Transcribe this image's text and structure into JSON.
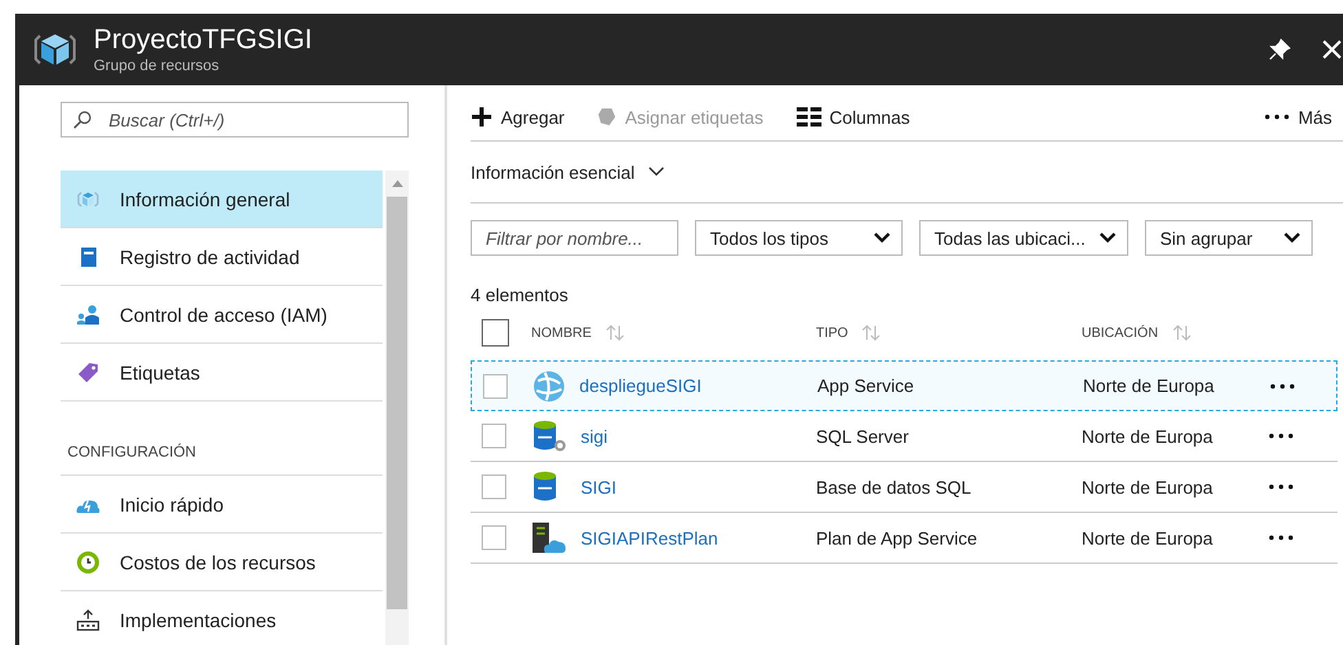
{
  "window": {
    "title": "ProyectoTFGSIGI",
    "subtitle": "Grupo de recursos"
  },
  "sidebar": {
    "search": {
      "placeholder": "Buscar (Ctrl+/)"
    },
    "items": [
      {
        "kind": "item",
        "label": "Información general",
        "selected": true
      },
      {
        "kind": "item",
        "label": "Registro de actividad",
        "selected": false
      },
      {
        "kind": "item",
        "label": "Control de acceso (IAM)",
        "selected": false
      },
      {
        "kind": "item",
        "label": "Etiquetas",
        "selected": false
      },
      {
        "kind": "heading",
        "label": "CONFIGURACIÓN"
      },
      {
        "kind": "item",
        "label": "Inicio rápido",
        "selected": false
      },
      {
        "kind": "item",
        "label": "Costos de los recursos",
        "selected": false
      },
      {
        "kind": "item",
        "label": "Implementaciones",
        "selected": false
      }
    ]
  },
  "toolbar": [
    {
      "label": "Agregar",
      "disabled": false
    },
    {
      "label": "Asignar etiquetas",
      "disabled": true
    },
    {
      "label": "Columnas",
      "disabled": false
    }
  ],
  "more": "Más",
  "essentials": "Información esencial",
  "filters": {
    "name": {
      "placeholder": "Filtrar por nombre..."
    },
    "dropdowns": [
      "Todos los tipos",
      "Todas las ubicaci...",
      "Sin agrupar"
    ]
  },
  "count": "4 elementos",
  "table": {
    "all_checked": false,
    "columns": [
      "NOMBRE",
      "TIPO",
      "UBICACIÓN"
    ],
    "rows": [
      {
        "name": "despliegueSIGI",
        "type": "App Service",
        "location": "Norte de Europa",
        "selected": true,
        "checked": false
      },
      {
        "name": "sigi",
        "type": "SQL Server",
        "location": "Norte de Europa",
        "selected": false,
        "checked": false
      },
      {
        "name": "SIGI",
        "type": "Base de datos SQL",
        "location": "Norte de Europa",
        "selected": false,
        "checked": false
      },
      {
        "name": "SIGIAPIRestPlan",
        "type": "Plan de App Service",
        "location": "Norte de Europa",
        "selected": false,
        "checked": false
      }
    ]
  }
}
